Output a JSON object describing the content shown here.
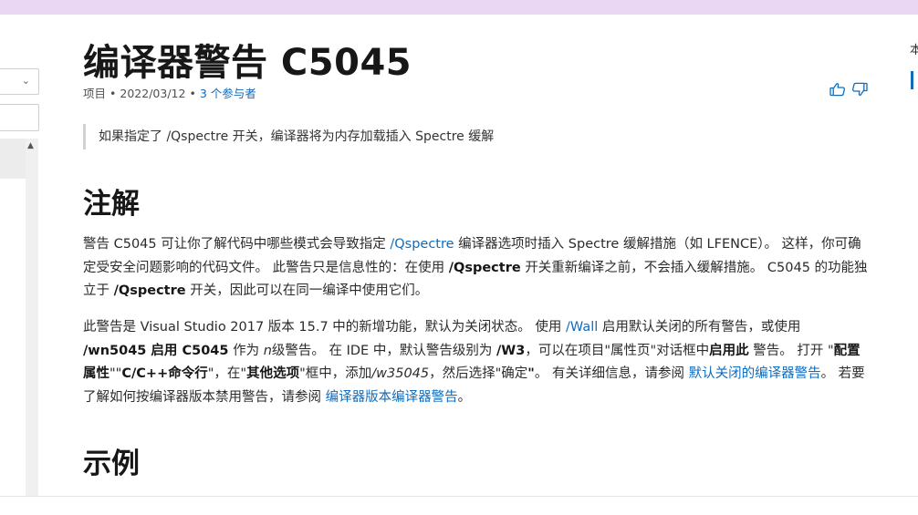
{
  "colors": {
    "accent": "#0f6cbd",
    "topbar": "#e9d7f4"
  },
  "article": {
    "title": "编译器警告 C5045",
    "meta": {
      "type": "项目",
      "date": "2022/03/12",
      "contributors": "3 个参与者"
    },
    "note": "如果指定了 /Qspectre 开关，编译器将为内存加载插入 Spectre 缓解",
    "remarks_heading": "注解",
    "example_heading": "示例",
    "p1": {
      "s1": "警告 C5045 可让你了解代码中哪些模式会导致指定",
      "link_qspectre": "/Qspectre",
      "s2": "编译器选项时插入 Spectre 缓解措施（如 LFENCE）。 这样，你可确定受安全问题影响的代码文件。 此警告只是信息性的：在使用",
      "b_qspectre1": "/Qspectre",
      "s3": "开关重新编译之前，不会插入缓解措施。 C5045 的功能独立于",
      "b_qspectre2": "/Qspectre",
      "s4": "开关，因此可以在同一编译中使用它们。"
    },
    "p2": {
      "s1": "此警告是 Visual Studio 2017 版本 15.7 中的新增功能，默认为关闭状态。 使用",
      "link_wall": "/Wall",
      "s2": "启用默认关闭的所有警告，或使用",
      "b_wn": "/wn5045 启用 C5045",
      "s3": "作为",
      "i_n": "n",
      "s3b": "级警告。 在 IDE 中，默认警告级别为",
      "b_w3": "/W3",
      "s4": "，可以在项目\"属性页\"对话框中",
      "b_enable": "启用此",
      "s5": "警告。 打开 \"",
      "b_config": "配置属性",
      "s6": "\"\"",
      "b_cmd": "C/C++命令行",
      "s7": "\"，在\"",
      "b_other": "其他选项",
      "s8": "\"框中，添加",
      "i_w35045": "/w35045",
      "s9": "，然后选择\"确定",
      "b_quote": "\"",
      "s10": "。 有关详细信息，请参阅",
      "link_default_off": "默认关闭的编译器警告",
      "s11": "。 若要了解如何按编译器版本禁用警告，请参阅",
      "link_by_version": "编译器版本编译器警告",
      "s12": "。"
    }
  },
  "right_rail": {
    "char": "本"
  },
  "icons": {
    "thumbs_up": "thumbs-up-icon",
    "thumbs_down": "thumbs-down-icon",
    "chevron": "chevron-down-icon",
    "scroll_up": "scroll-up-arrow-icon"
  }
}
